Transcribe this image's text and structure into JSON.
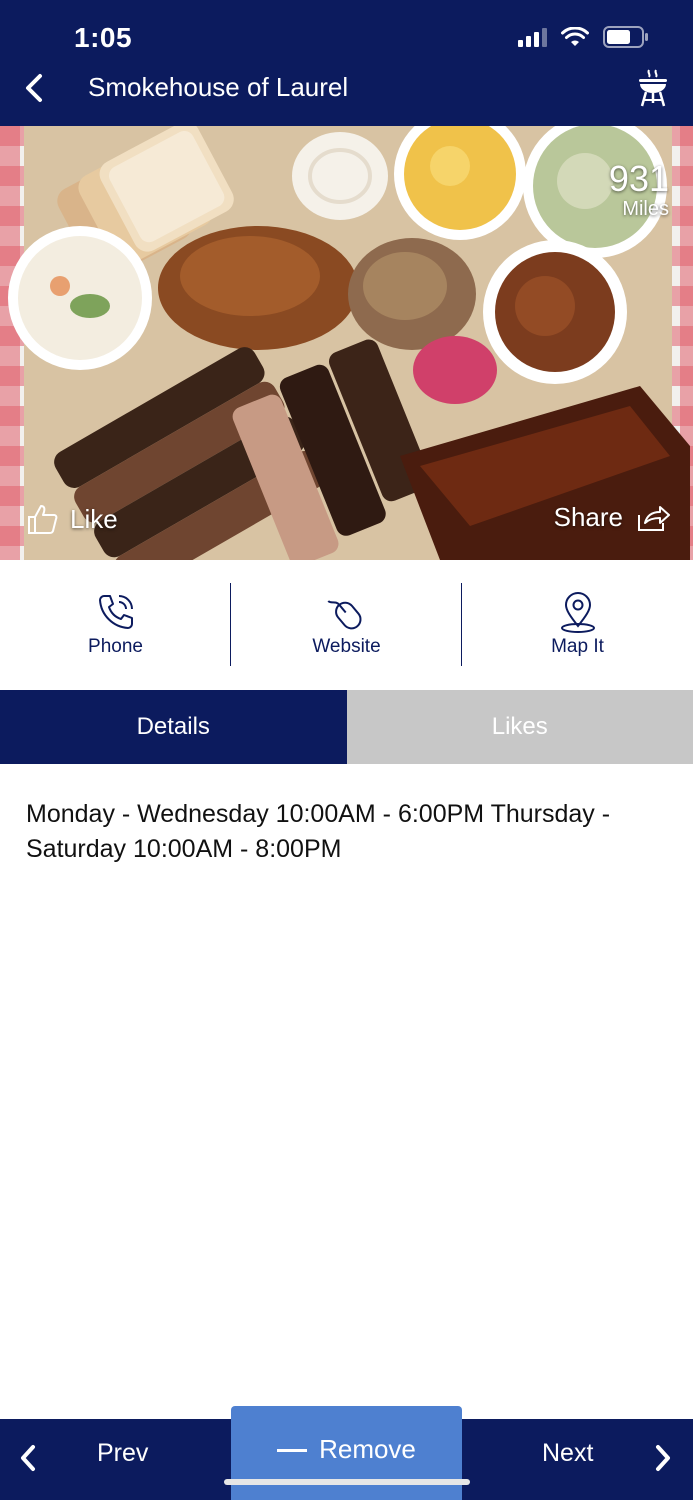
{
  "status_bar": {
    "time": "1:05"
  },
  "header": {
    "title": "Smokehouse of Laurel"
  },
  "hero": {
    "distance_value": "931",
    "distance_unit": "Miles",
    "like_label": "Like",
    "share_label": "Share"
  },
  "actions": {
    "phone_label": "Phone",
    "website_label": "Website",
    "map_label": "Map It"
  },
  "tabs": {
    "details_label": "Details",
    "likes_label": "Likes"
  },
  "details": {
    "hours": "Monday - Wednesday 10:00AM - 6:00PM Thursday - Saturday 10:00AM - 8:00PM"
  },
  "bottom_bar": {
    "prev_label": "Prev",
    "remove_label": "Remove",
    "next_label": "Next"
  },
  "colors": {
    "navy": "#0c1b5e",
    "remove_blue": "#4e80d0",
    "tab_inactive": "#c7c7c7"
  },
  "icons": [
    "back-chevron-icon",
    "grill-icon",
    "thumbs-up-icon",
    "share-arrow-icon",
    "phone-icon",
    "mouse-icon",
    "map-pin-icon",
    "minus-icon",
    "chevron-left-icon",
    "chevron-right-icon"
  ]
}
